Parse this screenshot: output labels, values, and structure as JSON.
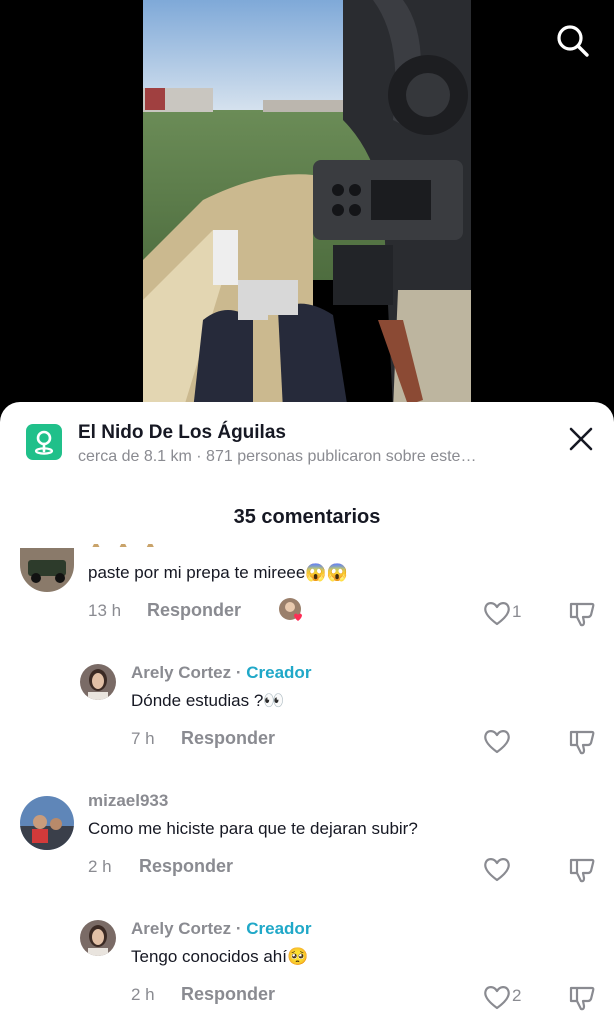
{
  "video": {
    "search_icon": "search-icon"
  },
  "location": {
    "title": "El Nido De Los Águilas",
    "subtitle": "cerca de 8.1 km · 871 personas publicaron sobre este…",
    "icon": "map-pin-icon",
    "accent": "#20c08a"
  },
  "comments_header": {
    "count_label": "35 comentarios"
  },
  "comments": [
    {
      "user": "",
      "text": "paste por mi prepa te mireee😱😱",
      "time": "13 h",
      "reply_label": "Responder",
      "likes": "1",
      "liked_by_creator": true
    },
    {
      "user": "Arely Cortez",
      "separator": " · ",
      "creator_badge": "Creador",
      "text": "Dónde estudias ?👀",
      "time": "7 h",
      "reply_label": "Responder",
      "likes": ""
    },
    {
      "user": "mizael933",
      "text": "Como me hiciste para que te dejaran subir?",
      "time": "2 h",
      "reply_label": "Responder",
      "likes": ""
    },
    {
      "user": "Arely Cortez",
      "separator": " · ",
      "creator_badge": "Creador",
      "text": "Tengo conocidos ahí🥺",
      "time": "2 h",
      "reply_label": "Responder",
      "likes": "2"
    }
  ],
  "colors": {
    "creator": "#20a8c8",
    "muted": "#8a8b91",
    "text": "#161823"
  }
}
